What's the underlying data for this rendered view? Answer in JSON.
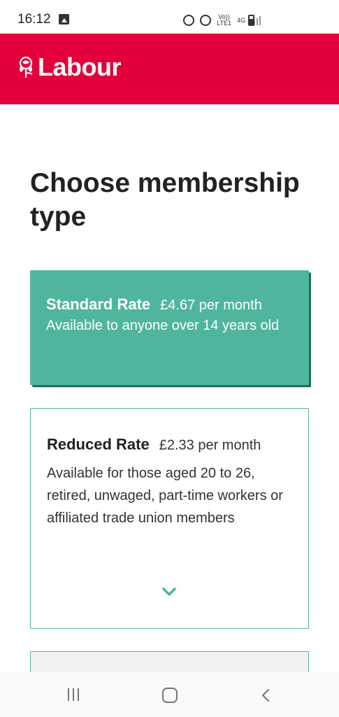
{
  "status_bar": {
    "time": "16:12",
    "vol_lte_top": "Vo))",
    "vol_lte_bottom": "LTE1",
    "network_type": "4G"
  },
  "header": {
    "logo_text": "Labour",
    "brand_color": "#e4003b"
  },
  "main": {
    "title": "Choose membership type",
    "cards": [
      {
        "name": "Standard Rate",
        "price": "£4.67 per month",
        "description": "Available to anyone over 14 years old",
        "selected": true
      },
      {
        "name": "Reduced Rate",
        "price": "£2.33 per month",
        "description": "Available for those aged 20 to 26, retired, unwaged, part-time workers or affiliated trade union members",
        "selected": false
      }
    ],
    "accent_color": "#50b59f"
  },
  "nav_bar": {
    "icons": [
      "recent-apps-icon",
      "home-icon",
      "back-icon"
    ]
  }
}
